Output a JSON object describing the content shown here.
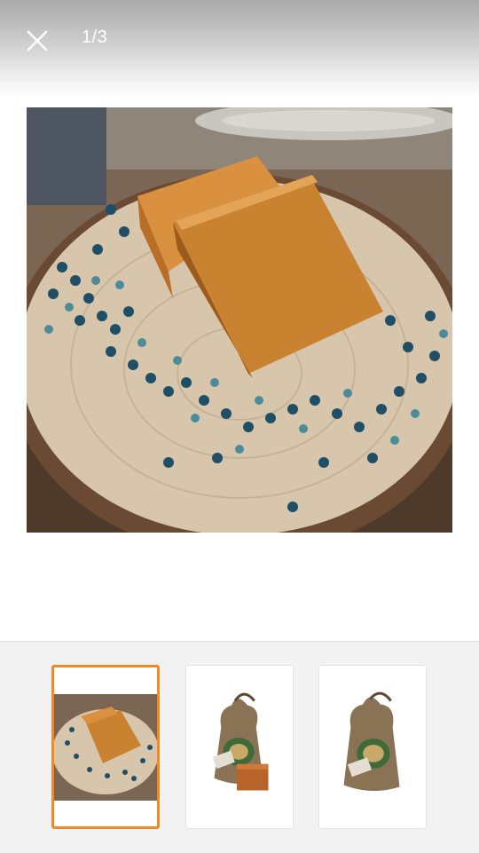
{
  "viewer": {
    "counter": "1/3",
    "close_icon": "close-icon"
  },
  "colors": {
    "active_border": "#f08a24",
    "strip_background": "#f2f2f2"
  },
  "thumbnails": [
    {
      "selected": true
    },
    {
      "selected": false
    },
    {
      "selected": false
    }
  ]
}
